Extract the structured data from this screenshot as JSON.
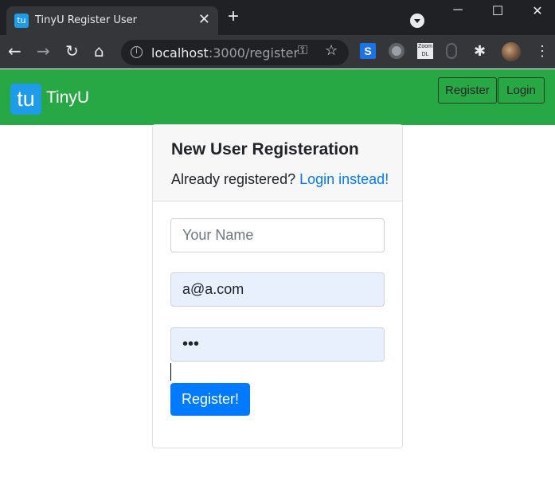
{
  "browser": {
    "tab_title": "TinyU Register User",
    "tab_favicon": "tu",
    "url_host": "localhost",
    "url_rest": ":3000/register",
    "icons": [
      "close-icon",
      "plus-icon",
      "back-icon",
      "forward-icon",
      "reload-icon",
      "home-icon",
      "info-icon",
      "key-icon",
      "star-icon",
      "extensions-icon",
      "menu-icon"
    ]
  },
  "navbar": {
    "logo_text": "tu",
    "brand": "TinyU",
    "register_label": "Register",
    "login_label": "Login",
    "color": "#28a745"
  },
  "card": {
    "title": "New User Registeration",
    "prompt": "Already registered?",
    "login_link": "Login instead!",
    "name_placeholder": "Your Name",
    "name_value": "",
    "email_value": "a@a.com",
    "password_value": "abc",
    "submit_label": "Register!",
    "accent": "#007bff"
  }
}
